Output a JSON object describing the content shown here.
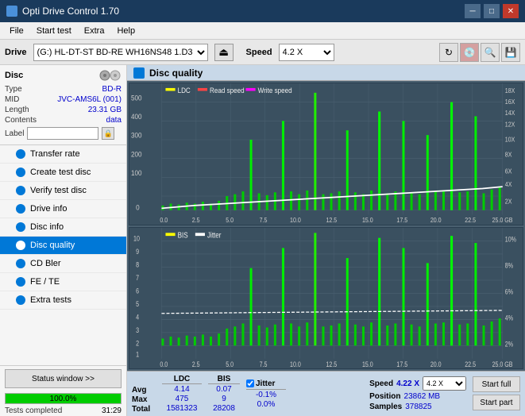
{
  "titlebar": {
    "title": "Opti Drive Control 1.70",
    "min_btn": "─",
    "max_btn": "□",
    "close_btn": "✕"
  },
  "menubar": {
    "items": [
      "File",
      "Start test",
      "Extra",
      "Help"
    ]
  },
  "drivebar": {
    "drive_label": "Drive",
    "drive_value": "(G:) HL-DT-ST BD-RE  WH16NS48 1.D3",
    "speed_label": "Speed",
    "speed_value": "4.2 X"
  },
  "disc": {
    "title": "Disc",
    "type_label": "Type",
    "type_value": "BD-R",
    "mid_label": "MID",
    "mid_value": "JVC-AMS6L (001)",
    "length_label": "Length",
    "length_value": "23.31 GB",
    "contents_label": "Contents",
    "contents_value": "data",
    "label_label": "Label",
    "label_placeholder": ""
  },
  "nav": {
    "items": [
      {
        "id": "transfer-rate",
        "label": "Transfer rate",
        "active": false
      },
      {
        "id": "create-test-disc",
        "label": "Create test disc",
        "active": false
      },
      {
        "id": "verify-test-disc",
        "label": "Verify test disc",
        "active": false
      },
      {
        "id": "drive-info",
        "label": "Drive info",
        "active": false
      },
      {
        "id": "disc-info",
        "label": "Disc info",
        "active": false
      },
      {
        "id": "disc-quality",
        "label": "Disc quality",
        "active": true
      },
      {
        "id": "cd-bler",
        "label": "CD Bler",
        "active": false
      },
      {
        "id": "fe-te",
        "label": "FE / TE",
        "active": false
      },
      {
        "id": "extra-tests",
        "label": "Extra tests",
        "active": false
      }
    ]
  },
  "status": {
    "status_btn": "Status window >>",
    "progress": "100.0%",
    "time": "31:29",
    "completed": "Tests completed"
  },
  "content": {
    "title": "Disc quality",
    "chart1": {
      "legend": [
        "LDC",
        "Read speed",
        "Write speed"
      ],
      "y_left": [
        "500",
        "400",
        "300",
        "200",
        "100",
        "0"
      ],
      "y_right": [
        "18X",
        "16X",
        "14X",
        "12X",
        "10X",
        "8X",
        "6X",
        "4X",
        "2X"
      ],
      "x_labels": [
        "0.0",
        "2.5",
        "5.0",
        "7.5",
        "10.0",
        "12.5",
        "15.0",
        "17.5",
        "20.0",
        "22.5",
        "25.0 GB"
      ]
    },
    "chart2": {
      "legend": [
        "BIS",
        "Jitter"
      ],
      "y_left": [
        "10",
        "9",
        "8",
        "7",
        "6",
        "5",
        "4",
        "3",
        "2",
        "1"
      ],
      "y_right": [
        "10%",
        "8%",
        "6%",
        "4%",
        "2%"
      ],
      "x_labels": [
        "0.0",
        "2.5",
        "5.0",
        "7.5",
        "10.0",
        "12.5",
        "15.0",
        "17.5",
        "20.0",
        "22.5",
        "25.0 GB"
      ]
    }
  },
  "stats": {
    "columns": [
      {
        "header": "LDC",
        "avg": "4.14",
        "max": "475",
        "total": "1581323"
      },
      {
        "header": "BIS",
        "avg": "0.07",
        "max": "9",
        "total": "28208"
      },
      {
        "header": "Jitter",
        "avg": "-0.1%",
        "max": "0.0%",
        "total": ""
      }
    ],
    "row_labels": [
      "Avg",
      "Max",
      "Total"
    ],
    "jitter_checked": true,
    "speed_label": "Speed",
    "speed_val": "4.22 X",
    "speed_select": "4.2 X",
    "position_label": "Position",
    "position_val": "23862 MB",
    "samples_label": "Samples",
    "samples_val": "378825",
    "start_full": "Start full",
    "start_part": "Start part"
  }
}
